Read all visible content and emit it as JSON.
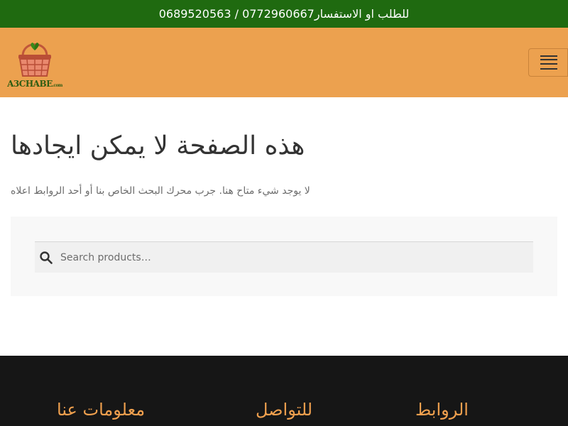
{
  "topbar": {
    "contact_text": "للطلب او الاستفسار0772960667 / 0689520563"
  },
  "header": {
    "logo_text": "A3CHABE",
    "logo_suffix": ".com",
    "menu_icon": "hamburger-menu-icon"
  },
  "main": {
    "title": "هذه الصفحة لا يمكن ايجادها",
    "description": "لا يوجد شيء متاح هنا. جرب محرك البحث الخاص بنا أو أحد الروابط اعلاه"
  },
  "search": {
    "placeholder": "Search products…",
    "icon": "search-icon"
  },
  "footer": {
    "headings": [
      "معلومات عنا",
      "للتواصل",
      "الروابط"
    ]
  },
  "colors": {
    "topbar_bg": "#1f6a10",
    "header_bg": "#eca14f",
    "footer_bg": "#161616",
    "footer_heading": "#f0a04e"
  }
}
